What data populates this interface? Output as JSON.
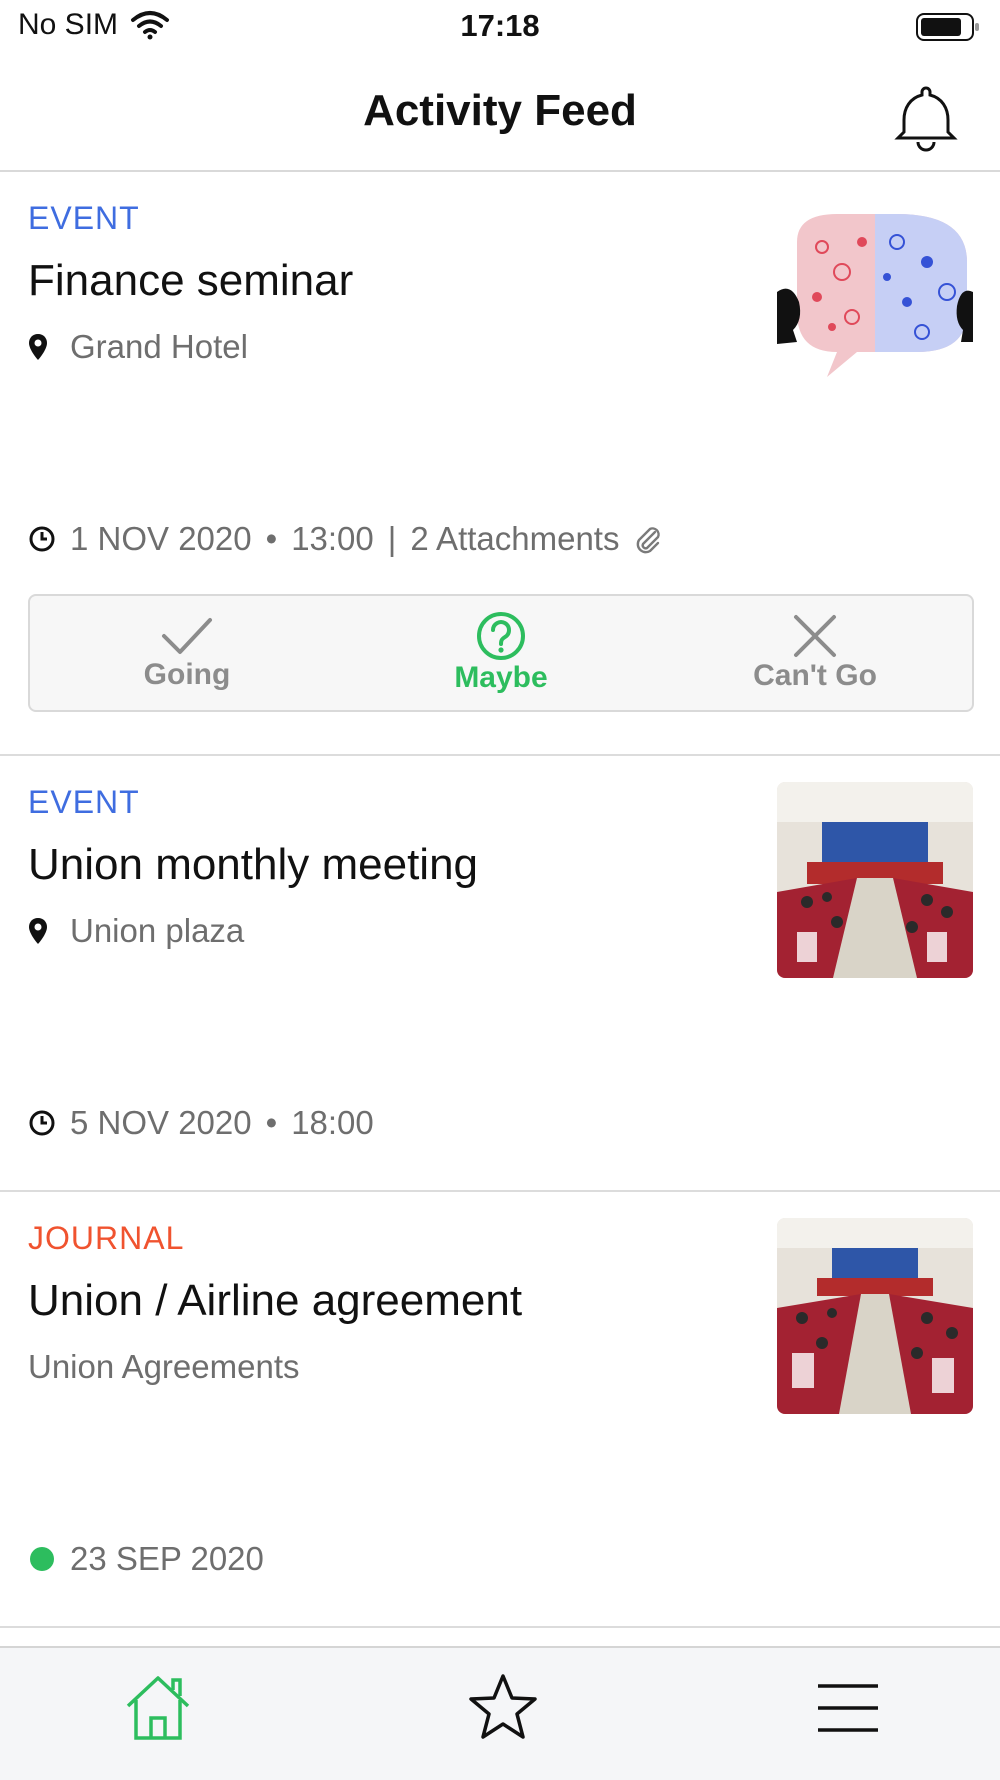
{
  "status_bar": {
    "carrier": "No SIM",
    "time": "17:18"
  },
  "header": {
    "title": "Activity Feed"
  },
  "feed": [
    {
      "category": "EVENT",
      "title": "Finance seminar",
      "location": "Grand Hotel",
      "date": "1 NOV 2020",
      "time": "13:00",
      "attachments": "2 Attachments",
      "rsvp": {
        "going": "Going",
        "maybe": "Maybe",
        "cant_go": "Can't Go",
        "selected": "maybe"
      }
    },
    {
      "category": "EVENT",
      "title": "Union monthly meeting",
      "location": "Union plaza",
      "date": "5 NOV 2020",
      "time": "18:00"
    },
    {
      "category": "JOURNAL",
      "title": "Union / Airline agreement",
      "subtitle": "Union Agreements",
      "date": "23 SEP 2020"
    }
  ],
  "colors": {
    "event": "#3f6de0",
    "journal": "#f0532f",
    "accent_green": "#2dbd5e",
    "muted": "#6e6e6e"
  },
  "tab_bar": {
    "items": [
      {
        "icon": "home-icon",
        "active": true
      },
      {
        "icon": "star-icon",
        "active": false
      },
      {
        "icon": "menu-icon",
        "active": false
      }
    ]
  },
  "meta_separator": "•",
  "meta_divider": "|"
}
